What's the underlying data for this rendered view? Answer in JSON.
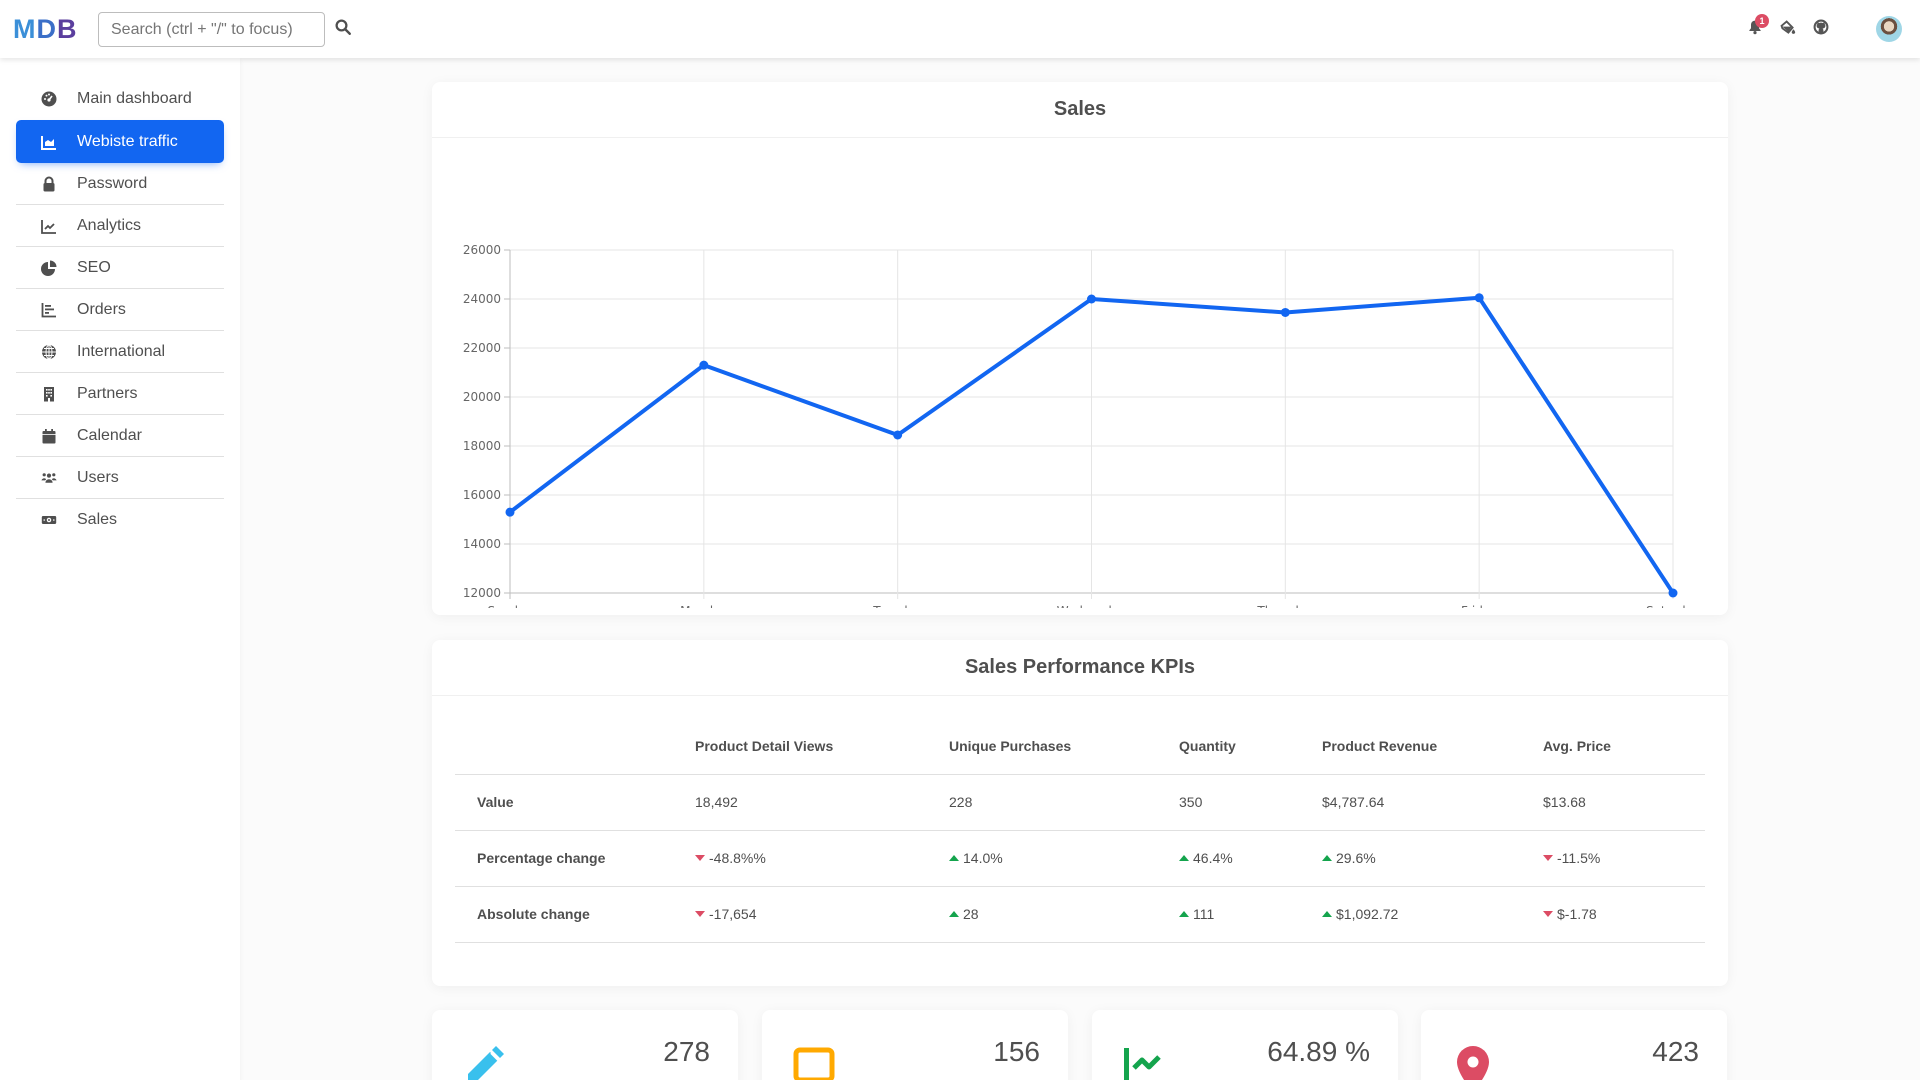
{
  "navbar": {
    "logo": {
      "m": "M",
      "d": "D",
      "b": "B"
    },
    "search_placeholder": "Search (ctrl + \"/\" to focus)",
    "notification_count": "1",
    "icons": [
      "bell-icon",
      "paint-bucket-icon",
      "github-icon"
    ]
  },
  "sidebar": {
    "items": [
      {
        "label": "Main dashboard",
        "icon": "gauge-icon",
        "active": false
      },
      {
        "label": "Webiste traffic",
        "icon": "area-chart-icon",
        "active": true
      },
      {
        "label": "Password",
        "icon": "lock-icon",
        "active": false
      },
      {
        "label": "Analytics",
        "icon": "line-chart-icon",
        "active": false
      },
      {
        "label": "SEO",
        "icon": "pie-chart-icon",
        "active": false
      },
      {
        "label": "Orders",
        "icon": "bar-chart-icon",
        "active": false
      },
      {
        "label": "International",
        "icon": "globe-icon",
        "active": false
      },
      {
        "label": "Partners",
        "icon": "building-icon",
        "active": false
      },
      {
        "label": "Calendar",
        "icon": "calendar-icon",
        "active": false
      },
      {
        "label": "Users",
        "icon": "users-icon",
        "active": false
      },
      {
        "label": "Sales",
        "icon": "money-icon",
        "active": false
      }
    ]
  },
  "sales_card": {
    "title": "Sales"
  },
  "chart_data": {
    "type": "line",
    "title": "Sales",
    "categories": [
      "Sunday",
      "Monday",
      "Tuesday",
      "Wednesday",
      "Thursday",
      "Friday",
      "Saturday"
    ],
    "series": [
      {
        "name": "Sales",
        "values": [
          15300,
          21300,
          18450,
          24000,
          23450,
          24050,
          12000
        ],
        "color": "#1266f1"
      }
    ],
    "y_ticks": [
      "26000",
      "24000",
      "22000",
      "20000",
      "18000",
      "16000",
      "14000",
      "12000"
    ],
    "ylim": [
      12000,
      26000
    ],
    "xlabel": "",
    "ylabel": "",
    "grid": true,
    "legend": "none"
  },
  "kpi_card": {
    "title": "Sales Performance KPIs",
    "columns": [
      "",
      "Product Detail Views",
      "Unique Purchases",
      "Quantity",
      "Product Revenue",
      "Avg. Price"
    ],
    "rows": [
      {
        "label": "Value",
        "cells": [
          {
            "text": "18,492",
            "trend": "none"
          },
          {
            "text": "228",
            "trend": "none"
          },
          {
            "text": "350",
            "trend": "none"
          },
          {
            "text": "$4,787.64",
            "trend": "none"
          },
          {
            "text": "$13.68",
            "trend": "none"
          }
        ]
      },
      {
        "label": "Percentage change",
        "cells": [
          {
            "text": "-48.8%%",
            "trend": "down"
          },
          {
            "text": "14.0%",
            "trend": "up"
          },
          {
            "text": "46.4%",
            "trend": "up"
          },
          {
            "text": "29.6%",
            "trend": "up"
          },
          {
            "text": "-11.5%",
            "trend": "down"
          }
        ]
      },
      {
        "label": "Absolute change",
        "cells": [
          {
            "text": "-17,654",
            "trend": "down"
          },
          {
            "text": "28",
            "trend": "up"
          },
          {
            "text": "111",
            "trend": "up"
          },
          {
            "text": "$1,092.72",
            "trend": "up"
          },
          {
            "text": "$-1.78",
            "trend": "down"
          }
        ]
      }
    ]
  },
  "stats": [
    {
      "value": "278",
      "icon": "pencil-icon",
      "color": "#39c0ed"
    },
    {
      "value": "156",
      "icon": "comment-icon",
      "color": "#ffa900"
    },
    {
      "value": "64.89 %",
      "icon": "trend-chart-icon",
      "color": "#14a44d"
    },
    {
      "value": "423",
      "icon": "map-marker-icon",
      "color": "#dc4c64"
    }
  ],
  "colors": {
    "primary": "#1266f1",
    "success": "#14a44d",
    "danger": "#dc4c64",
    "warning": "#ffa900",
    "info": "#39c0ed"
  }
}
